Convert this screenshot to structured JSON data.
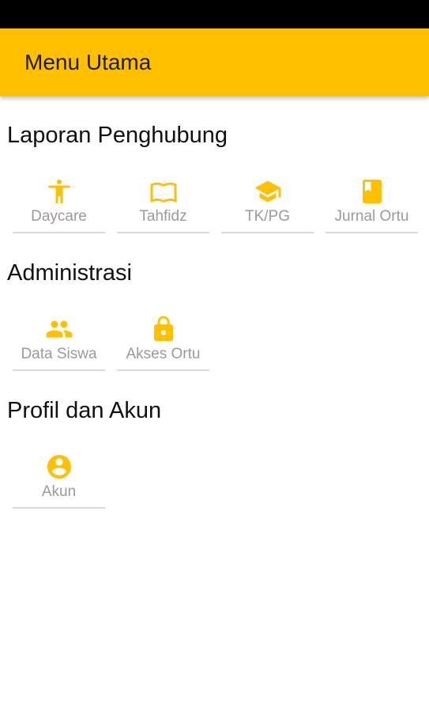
{
  "app_bar": {
    "title": "Menu Utama"
  },
  "theme": {
    "accent": "#FFC000",
    "status_bar": "#000000"
  },
  "sections": [
    {
      "title": "Laporan Penghubung",
      "items": [
        {
          "label": "Daycare",
          "icon": "accessibility-icon"
        },
        {
          "label": "Tahfidz",
          "icon": "open-book-icon"
        },
        {
          "label": "TK/PG",
          "icon": "graduation-cap-icon"
        },
        {
          "label": "Jurnal Ortu",
          "icon": "journal-book-icon"
        }
      ]
    },
    {
      "title": "Administrasi",
      "items": [
        {
          "label": "Data Siswa",
          "icon": "people-icon"
        },
        {
          "label": "Akses Ortu",
          "icon": "lock-icon"
        }
      ]
    },
    {
      "title": "Profil dan Akun",
      "items": [
        {
          "label": "Akun",
          "icon": "account-circle-icon"
        }
      ]
    }
  ]
}
